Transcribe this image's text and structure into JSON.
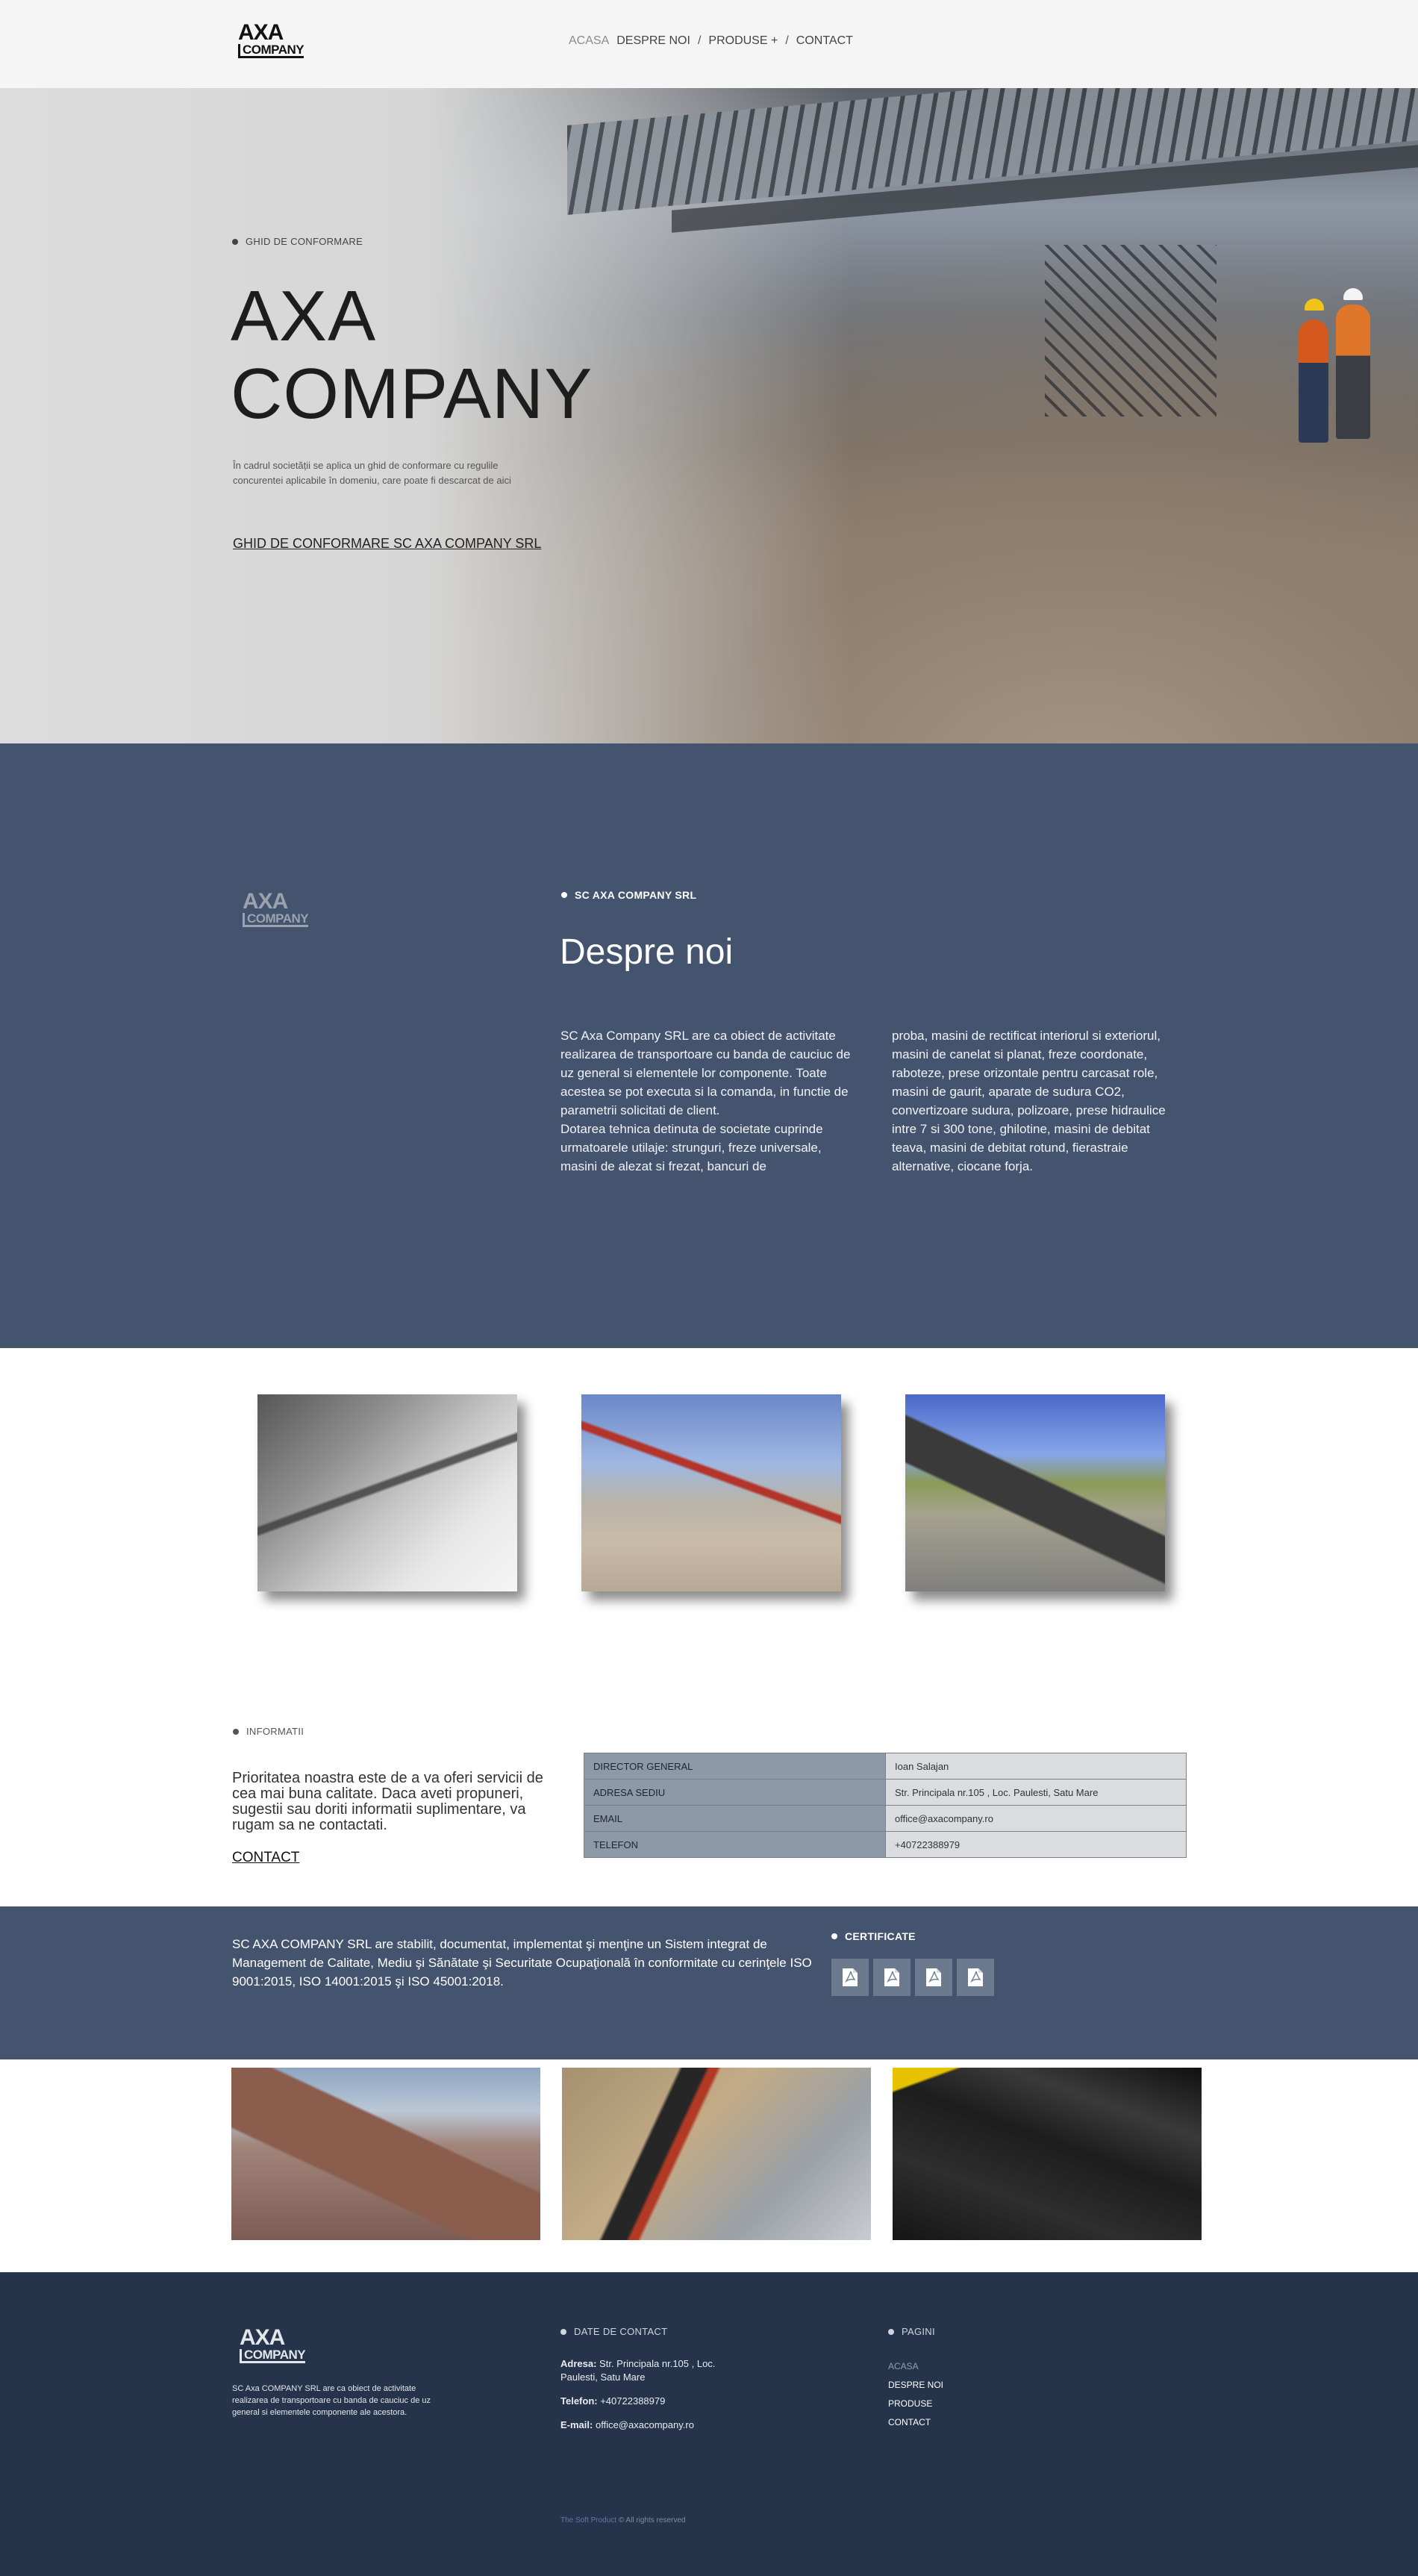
{
  "header": {
    "logo": {
      "line1": "AXA",
      "line2": "COMPANY"
    },
    "nav": [
      {
        "label": "ACASA",
        "active": true
      },
      {
        "label": "DESPRE NOI"
      },
      {
        "label": "PRODUSE +"
      },
      {
        "label": "CONTACT"
      }
    ],
    "separator": "/"
  },
  "hero": {
    "eyebrow": "GHID DE CONFORMARE",
    "title_line1": "AXA",
    "title_line2": "COMPANY",
    "description": "În cadrul societății se aplica un ghid de conformare cu regulile concurentei aplicabile în domeniu, care poate fi descarcat de aici",
    "link": "GHID DE CONFORMARE SC AXA COMPANY SRL"
  },
  "about": {
    "logo": {
      "line1": "AXA",
      "line2": "COMPANY"
    },
    "eyebrow": "SC AXA COMPANY SRL",
    "title": "Despre noi",
    "col1": "     SC Axa Company SRL are ca obiect de activitate realizarea de transportoare  cu banda de cauciuc de uz general si elementele lor componente. Toate acestea se pot  executa si la comanda,  in functie de parametrii solicitati de client.\n     Dotarea tehnica detinuta de societate cuprinde urmatoarele utilaje: strunguri, freze universale, masini de alezat si frezat, bancuri de",
    "col2": "proba, masini de rectificat interiorul si exteriorul, masini de canelat si planat, freze coordonate, raboteze, prese orizontale pentru carcasat role, masini de gaurit, aparate de sudura CO2, convertizoare sudura, polizoare, prese hidraulice intre 7 si 300 tone, ghilotine, masini de debitat teava, masini de debitat rotund, fierastraie alternative, ciocane forja."
  },
  "info": {
    "eyebrow": "INFORMATII",
    "text": "Prioritatea noastra este de a va oferi servicii de cea mai buna calitate. Daca aveti propuneri, sugestii sau doriti informatii suplimentare, va rugam sa ne contactati.",
    "contact_link": "CONTACT",
    "table": [
      {
        "key": "DIRECTOR GENERAL",
        "value": "Ioan Salajan"
      },
      {
        "key": "ADRESA SEDIU",
        "value": "Str. Principala nr.105 , Loc. Paulesti, Satu Mare"
      },
      {
        "key": "EMAIL",
        "value": "office@axacompany.ro"
      },
      {
        "key": "TELEFON",
        "value": "+40722388979"
      }
    ]
  },
  "certificates": {
    "text": "SC AXA COMPANY SRL are stabilit, documentat, implementat şi menţine un Sistem integrat de Management de Calitate, Mediu şi Sănătate şi Securitate Ocupaţională în conformitate cu cerinţele ISO 9001:2015, ISO 14001:2015 şi ISO 45001:2018.",
    "eyebrow": "CERTIFICATE",
    "icons": [
      "pdf-icon",
      "pdf-icon",
      "pdf-icon",
      "pdf-icon"
    ]
  },
  "footer": {
    "logo": {
      "line1": "AXA",
      "line2": "COMPANY"
    },
    "about": "SC Axa COMPANY SRL are ca obiect de activitate realizarea de transportoare cu banda de cauciuc de uz general si elementele componente ale acestora.",
    "contact_eyebrow": "DATE DE CONTACT",
    "address_label": "Adresa:",
    "address": "Str. Principala nr.105 , Loc. Paulesti, Satu Mare",
    "phone_label": "Telefon:",
    "phone": "+40722388979",
    "email_label": "E-mail:",
    "email": "office@axacompany.ro",
    "pages_eyebrow": "PAGINI",
    "pages": [
      {
        "label": "ACASA",
        "active": true
      },
      {
        "label": "DESPRE NOI"
      },
      {
        "label": "PRODUSE"
      },
      {
        "label": "CONTACT"
      }
    ],
    "copyright_link": "The Soft Product",
    "copyright_text": "© All rights reserved"
  },
  "colors": {
    "band": "#44546e",
    "footer": "#26344b",
    "table_key": "#8e99a8",
    "table_value": "#dadcdf"
  }
}
